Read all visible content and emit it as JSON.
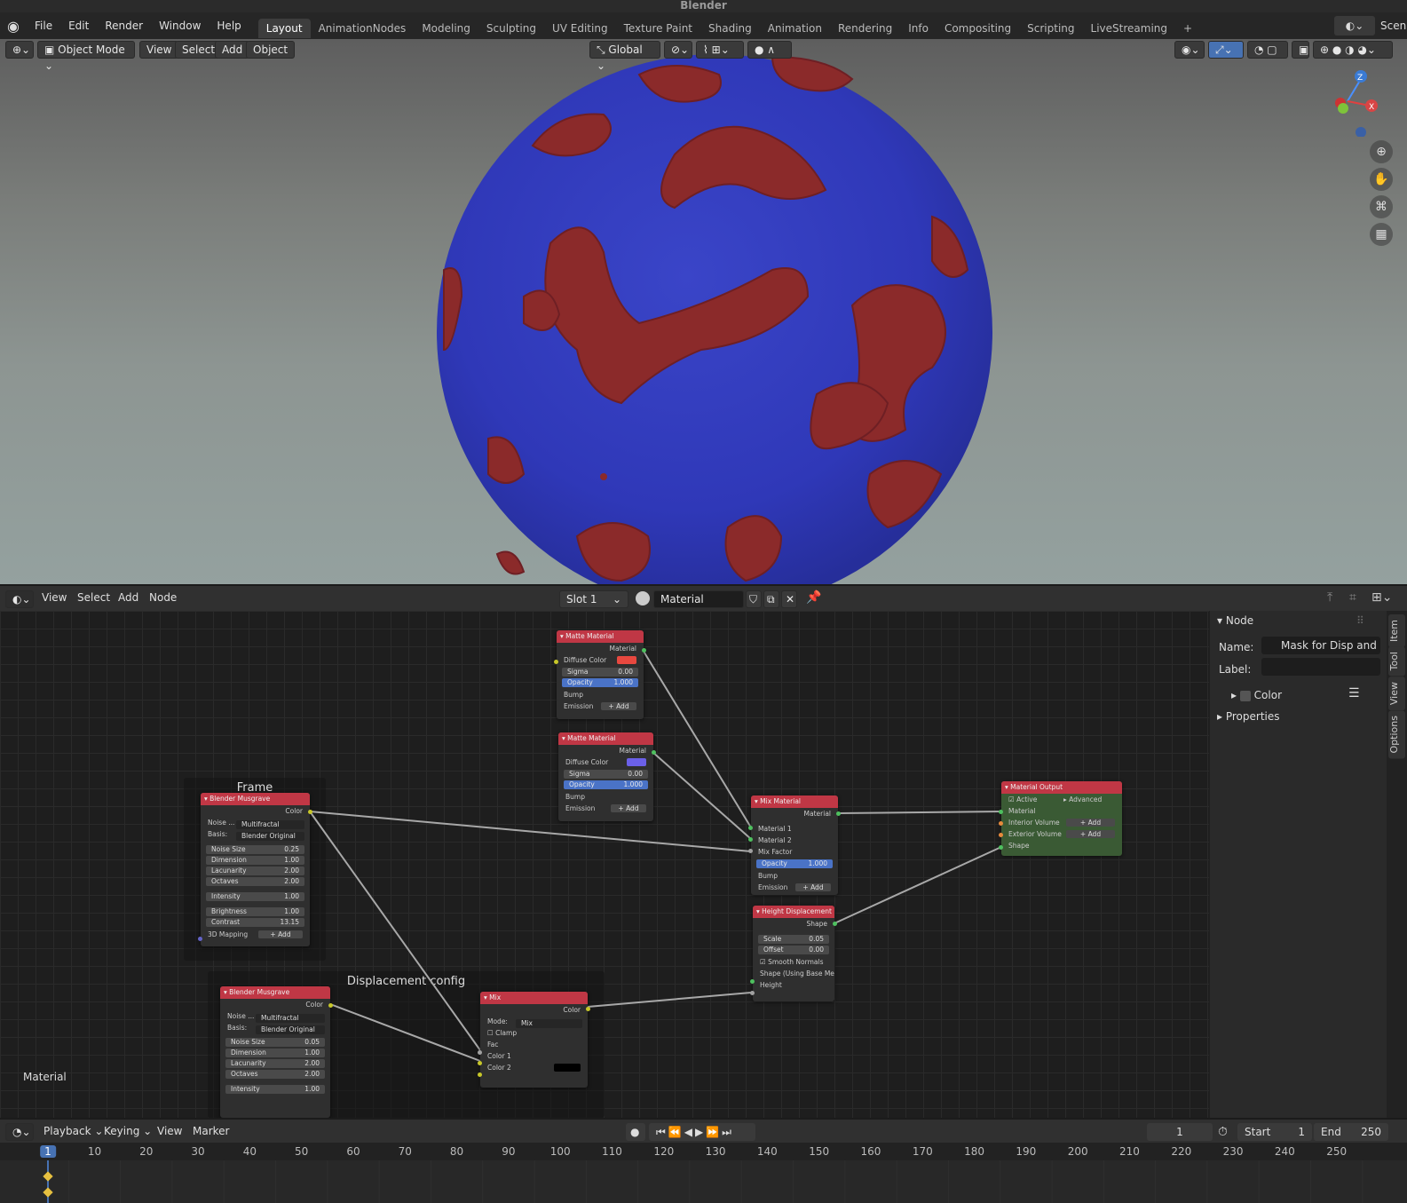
{
  "app": {
    "title": "Blender"
  },
  "menubar": {
    "menus": [
      "File",
      "Edit",
      "Render",
      "Window",
      "Help"
    ],
    "workspaces": [
      "Layout",
      "AnimationNodes",
      "Modeling",
      "Sculpting",
      "UV Editing",
      "Texture Paint",
      "Shading",
      "Animation",
      "Rendering",
      "Info",
      "Compositing",
      "Scripting",
      "LiveStreaming"
    ],
    "active_workspace": "Layout",
    "add_tab": "+",
    "scene_label": "Scen"
  },
  "viewport_header": {
    "mode": "Object Mode",
    "menus": [
      "View",
      "Select",
      "Add",
      "Object"
    ],
    "transform_orientation": "Global"
  },
  "node_header": {
    "menus": [
      "View",
      "Select",
      "Add",
      "Node"
    ],
    "slot": "Slot 1",
    "material": "Material"
  },
  "node_editor": {
    "context_label": "Material",
    "frames": {
      "frame1": "Frame",
      "frame2": "Displacement config"
    },
    "matte1": {
      "title": "Matte Material",
      "output": "Material",
      "diffuse": "Diffuse Color",
      "diffuse_color": "#e8483f",
      "sigma": "Sigma",
      "sigma_v": "0.00",
      "opacity": "Opacity",
      "opacity_v": "1.000",
      "bump": "Bump",
      "emission": "Emission",
      "add": "Add"
    },
    "matte2": {
      "title": "Matte Material",
      "output": "Material",
      "diffuse": "Diffuse Color",
      "diffuse_color": "#6b60e8",
      "sigma": "Sigma",
      "sigma_v": "0.00",
      "opacity": "Opacity",
      "opacity_v": "1.000",
      "bump": "Bump",
      "emission": "Emission",
      "add": "Add"
    },
    "musgrave1": {
      "title": "Blender Musgrave",
      "output": "Color",
      "noise_label": "Noise ...",
      "noise": "Multifractal",
      "basis_label": "Basis:",
      "basis": "Blender Original",
      "rows": [
        {
          "k": "Noise Size",
          "v": "0.25"
        },
        {
          "k": "Dimension",
          "v": "1.00"
        },
        {
          "k": "Lacunarity",
          "v": "2.00"
        },
        {
          "k": "Octaves",
          "v": "2.00"
        },
        {
          "k": "Intensity",
          "v": "1.00"
        },
        {
          "k": "Brightness",
          "v": "1.00"
        },
        {
          "k": "Contrast",
          "v": "13.15"
        }
      ],
      "mapping": "3D Mapping",
      "add": "Add"
    },
    "musgrave2": {
      "title": "Blender Musgrave",
      "output": "Color",
      "noise_label": "Noise ...",
      "noise": "Multifractal",
      "basis_label": "Basis:",
      "basis": "Blender Original",
      "rows": [
        {
          "k": "Noise Size",
          "v": "0.05"
        },
        {
          "k": "Dimension",
          "v": "1.00"
        },
        {
          "k": "Lacunarity",
          "v": "2.00"
        },
        {
          "k": "Octaves",
          "v": "2.00"
        },
        {
          "k": "Intensity",
          "v": "1.00"
        }
      ]
    },
    "mixmat": {
      "title": "Mix Material",
      "output": "Material",
      "m1": "Material 1",
      "m2": "Material 2",
      "fac": "Mix Factor",
      "opacity": "Opacity",
      "opacity_v": "1.000",
      "bump": "Bump",
      "emission": "Emission",
      "add": "Add"
    },
    "output": {
      "title": "Material Output",
      "active": "Active",
      "advanced": "Advanced",
      "material": "Material",
      "interior": "Interior Volume",
      "exterior": "Exterior Volume",
      "shape": "Shape",
      "add": "Add"
    },
    "height": {
      "title": "Height Displacement",
      "output": "Shape",
      "scale": "Scale",
      "scale_v": "0.05",
      "offset": "Offset",
      "offset_v": "0.00",
      "smooth": "Smooth Normals",
      "shape_in": "Shape (Using Base Mesh",
      "height_in": "Height"
    },
    "mix": {
      "title": "Mix",
      "output": "Color",
      "mode_label": "Mode:",
      "mode": "Mix",
      "clamp": "Clamp",
      "fac": "Fac",
      "c1": "Color 1",
      "c2": "Color 2"
    }
  },
  "sidebar": {
    "panel": "Node",
    "name_label": "Name:",
    "name_value": "Mask for Disp and M...",
    "label_label": "Label:",
    "color": "Color",
    "properties": "Properties",
    "tabs": [
      "Item",
      "Tool",
      "View",
      "Options"
    ]
  },
  "timeline": {
    "menus": [
      "Playback",
      "Keying",
      "View",
      "Marker"
    ],
    "current_frame": "1",
    "start_label": "Start",
    "start": "1",
    "end_label": "End",
    "end": "250",
    "ticks": [
      "1",
      "10",
      "20",
      "30",
      "40",
      "50",
      "60",
      "70",
      "80",
      "90",
      "100",
      "110",
      "120",
      "130",
      "140",
      "150",
      "160",
      "170",
      "180",
      "190",
      "200",
      "210",
      "220",
      "230",
      "240",
      "250"
    ]
  }
}
